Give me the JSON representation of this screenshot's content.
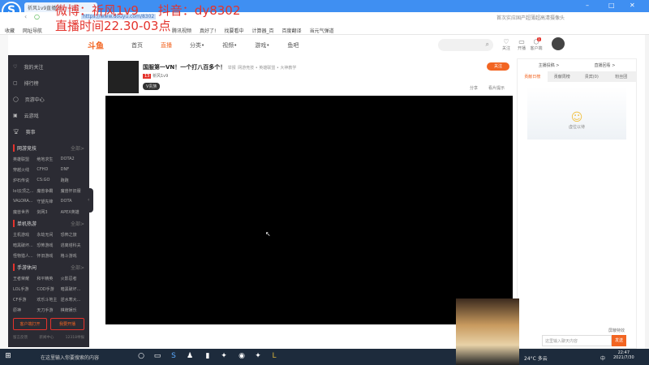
{
  "browser": {
    "tab_title": "祈风1v9直播间",
    "url": "https://www.douyu.com/8302",
    "search_placeholder": "首次实应国产超薄超高清摄像头",
    "bookmarks": [
      "收藏",
      "网址导航",
      "腾讯视频",
      "真好了!",
      "找要看中",
      "计算器_百",
      "百度翻译",
      "当元气弹道"
    ]
  },
  "overlay": {
    "line1": "微博：祈风1v9     抖音：dy8302",
    "line2": "直播时间22.30-03点"
  },
  "nav": {
    "logo": "斗鱼",
    "items": [
      "首页",
      "直播",
      "分类•",
      "视频•",
      "游戏•",
      "鱼吧"
    ],
    "icons": [
      "关注",
      "开播",
      "客户端"
    ],
    "badge": "1"
  },
  "sidebar": {
    "items": [
      "我的关注",
      "排行榜",
      "页游中心",
      "云游戏",
      "赛事"
    ],
    "sections": [
      {
        "title": "网游竞技",
        "more": "全部>",
        "games": [
          "英雄联盟",
          "绝地求生",
          "DOTA2",
          "穿越火线",
          "CFHD",
          "DNF",
          "炉石传说",
          "CS:GO",
          "跑跑",
          "lol云顶之...",
          "魔兽争霸",
          "魔兽怀旧服",
          "VALORA...",
          "守望先锋",
          "DOTA",
          "魔兽世界",
          "剑网3",
          "APEX英雄"
        ]
      },
      {
        "title": "单机热游",
        "more": "全部>",
        "games": [
          "主机游戏",
          "永劫无间",
          "恐怖之旅",
          "暗黑破坏...",
          "恐怖游戏",
          "逃离塔科夫",
          "怪物猎人...",
          "怀旧游戏",
          "格斗游戏"
        ]
      },
      {
        "title": "手游休闲",
        "more": "全部>",
        "games": [
          "王者荣耀",
          "和平精英",
          "火影忍者",
          "LOL手游",
          "COD手游",
          "暗黑破坏...",
          "CF手游",
          "欢乐斗地主",
          "逆水寒大...",
          "原神",
          "天刀手游",
          "棋牌娱乐"
        ]
      }
    ],
    "buttons": [
      "客户端打开",
      "我要开播"
    ],
    "footer": [
      "留言反馈",
      "新闻中心",
      "12318举报"
    ]
  },
  "room": {
    "title": "国服第一VN！一个打八百多个！",
    "tag": "举报",
    "category": "网游竞技 • 英雄联盟 • 大神教学",
    "level": "13",
    "streamer": "祈风1v9",
    "vip": "V贵族",
    "follow": "关注",
    "share": "分享",
    "report": "看片提示"
  },
  "right": {
    "links": [
      "主播投稿 >",
      "直播回看 >"
    ],
    "tabs": [
      "贡献日榜",
      "贡献周榜",
      "贵宾(0)",
      "粉丝团"
    ],
    "empty": "虚位以待",
    "chat_placeholder": "这里输入聊天内容",
    "send": "发送",
    "checkbox": "屏蔽特效"
  },
  "taskbar": {
    "search": "在这里输入你要搜索的内容",
    "weather": "24°C 多云",
    "time": "22:47",
    "date": "2021/7/30",
    "ime": "中"
  }
}
